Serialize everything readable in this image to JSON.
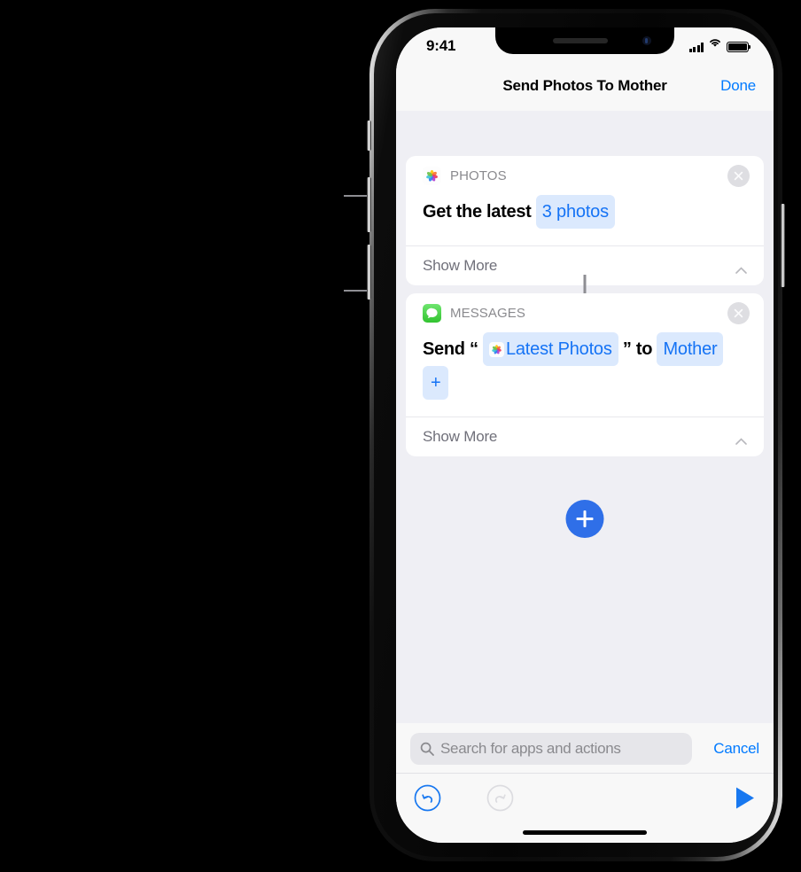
{
  "phone": {
    "hardware_buttons": [
      "mute-switch",
      "volume-up",
      "volume-down",
      "power"
    ]
  },
  "status_bar": {
    "time": "9:41",
    "signal_icon": "cellular-signal-icon",
    "wifi_icon": "wifi-icon",
    "battery_icon": "battery-full-icon"
  },
  "nav_bar": {
    "title": "Send Photos To Mother",
    "done_label": "Done"
  },
  "actions": [
    {
      "app_name": "PHOTOS",
      "app_icon": "photos-app-icon",
      "close_icon": "close-circle-icon",
      "body": {
        "prefix": "Get the latest",
        "parameter": "3 photos"
      },
      "show_more_label": "Show More",
      "chevron_icon": "chevron-up-icon"
    },
    {
      "app_name": "MESSAGES",
      "app_icon": "messages-app-icon",
      "close_icon": "close-circle-icon",
      "body": {
        "prefix": "Send",
        "open_quote": "“",
        "variable_icon": "photos-app-icon",
        "variable": "Latest Photos",
        "close_quote": "”",
        "connector": "to",
        "recipient": "Mother",
        "add_recipient": "+"
      },
      "show_more_label": "Show More",
      "chevron_icon": "chevron-up-icon"
    }
  ],
  "add_action_button": {
    "icon": "plus-icon",
    "color": "#2f6fe8"
  },
  "search": {
    "placeholder": "Search for apps and actions",
    "icon": "search-icon",
    "cancel_label": "Cancel"
  },
  "toolbar": {
    "undo_icon": "undo-arrow-icon",
    "redo_icon": "redo-arrow-icon",
    "play_icon": "play-triangle-icon"
  },
  "home_indicator": "home-indicator-bar",
  "colors": {
    "accent_blue": "#007aff",
    "pill_blue": "#1573f5",
    "pill_bg": "#dbe9fd",
    "screen_bg": "#efeff4",
    "card_bg": "#ffffff",
    "messages_green": "#4cd964"
  }
}
